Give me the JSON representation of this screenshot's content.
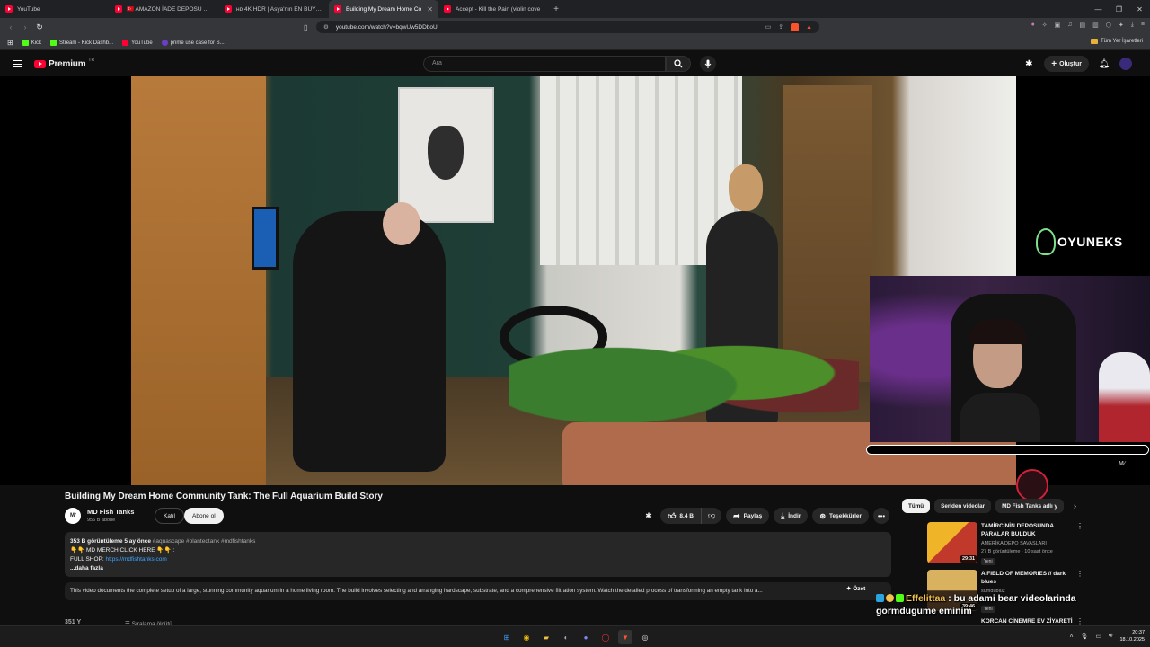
{
  "browser": {
    "tabs": [
      {
        "label": "YouTube",
        "active": false
      },
      {
        "label": "🇹🇷 AMAZON İADE DEPOSU 🇹🇷 🤑 Ka",
        "active": false
      },
      {
        "label": "ʜᴅ 4K HDR | Asya'nın EN BÜYÜK Akva",
        "active": false
      },
      {
        "label": "Building My Dream Home Co",
        "active": true
      },
      {
        "label": "Accept - Kill the Pain (violin cove",
        "active": false
      }
    ],
    "new_tab": "+",
    "url": "youtube.com/watch?v=bqwUw5DDboU",
    "bookmarks": [
      {
        "label": "Kick",
        "color": "#53fc18"
      },
      {
        "label": "Stream - Kick Dashb...",
        "color": "#53fc18"
      },
      {
        "label": "YouTube",
        "color": "#ff0033"
      },
      {
        "label": "prime use case for S...",
        "color": "#6b3ec7"
      }
    ],
    "bookmarks_folder": "Tüm Yer İşaretleri"
  },
  "header": {
    "logo_word": "Premium",
    "logo_country": "TR",
    "search_placeholder": "Ara",
    "create_label": "Oluştur"
  },
  "overlay": {
    "brand_text": "OYUNEKS",
    "channel_watermark": "M∕"
  },
  "video": {
    "title": "Building My Dream Home Community Tank: The Full Aquarium Build Story",
    "channel_name": "MD Fish Tanks",
    "channel_avatar_text": "M∕",
    "subscribers": "956 B abone",
    "join_label": "Katıl",
    "subscribe_label": "Abone ol",
    "likes": "8,4 B",
    "share_label": "Paylaş",
    "download_label": "İndir",
    "thanks_label": "Teşekkürler",
    "description": {
      "meta": "353 B görüntüleme  5 ay önce",
      "tags": "#aquascape #plantedtank #mdfishtanks",
      "line1": "👇👇 MD MERCH CLICK HERE 👇👇 :",
      "line2_prefix": "FULL SHOP: ",
      "link": "https://mdfishtanks.com",
      "more": "...daha fazla"
    },
    "summary": "This video documents the complete setup of a large, stunning community aquarium in a home living room. The build involves selecting and arranging hardscape, substrate, and a comprehensive filtration system. Watch the detailed process of transforming an empty tank into a...",
    "summary_button": "✦ Özet",
    "comments_count": "351 Y",
    "sort_label": "Sıralama ölçütü"
  },
  "sidebar": {
    "chips": [
      {
        "label": "Tümü",
        "active": true
      },
      {
        "label": "Seriden videolar",
        "active": false
      },
      {
        "label": "MD Fish Tanks adlı y",
        "active": false
      }
    ],
    "recommendations": [
      {
        "title": "TAMİRCİNİN DEPOSUNDA PARALAR BULDUK",
        "channel": "AMERİKA DEPO SAVAŞLARI",
        "views": "27 B görüntüleme · 10 saat önce",
        "badge": "Yeni",
        "duration": "29:31",
        "thumb_colors": [
          "#f0b429",
          "#c0392b"
        ]
      },
      {
        "title": "A FIELD OF MEMORIES // dark blues",
        "channel": "sumdubluz",
        "views": "",
        "badge": "Yeni",
        "duration": "39:46",
        "thumb_colors": [
          "#3b2a1a",
          "#d9b25f"
        ]
      },
      {
        "title": "KORCAN CİNEMRE EV ZİYARETİ",
        "channel": "",
        "views": "",
        "badge": "",
        "duration": "",
        "thumb_colors": [
          "#555",
          "#333"
        ]
      }
    ]
  },
  "chat": {
    "username": "Effelittaa",
    "message_1": " : bu adami bear videolarinda",
    "message_2": "gormdugume eminim"
  },
  "taskbar": {
    "time": "20:37",
    "date": "18.10.2025"
  }
}
